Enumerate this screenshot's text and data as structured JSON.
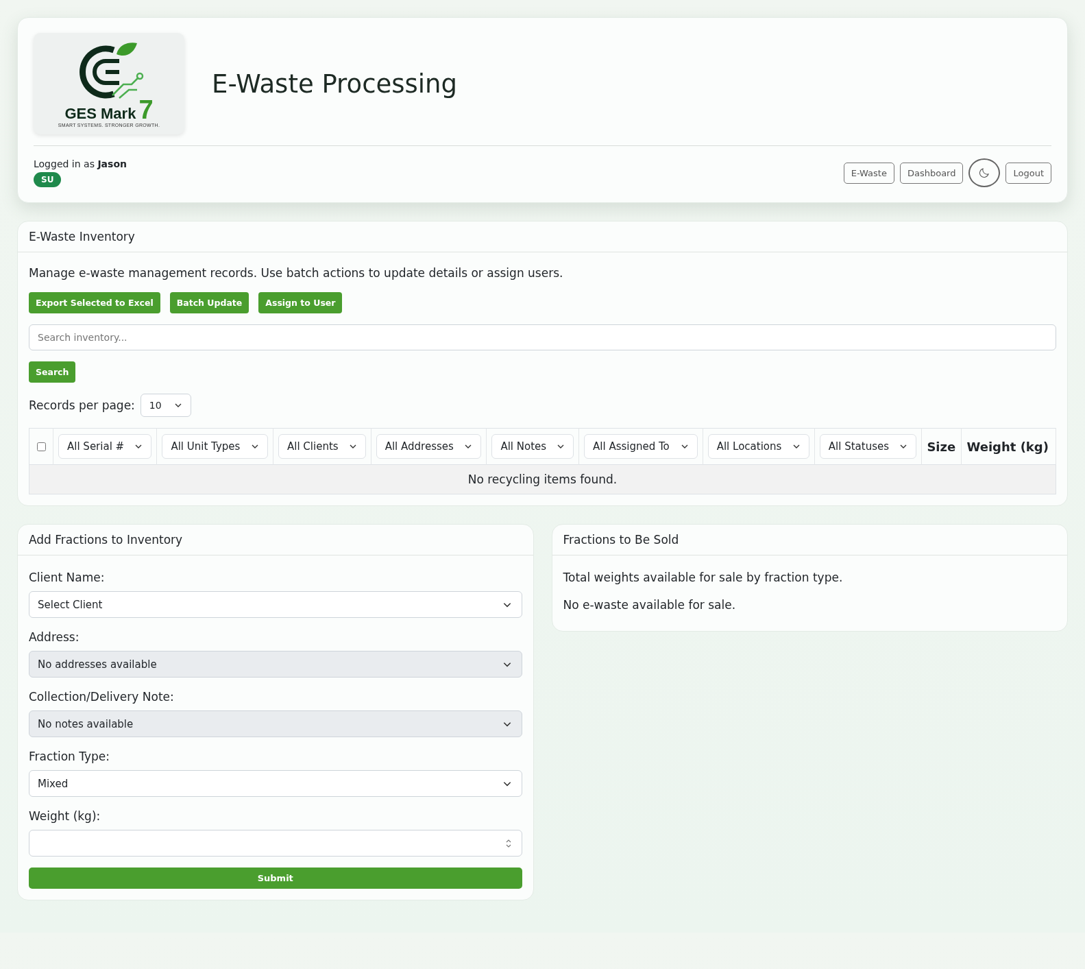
{
  "header": {
    "logo": {
      "brand": "GES Mark",
      "number": "7",
      "tagline": "SMART SYSTEMS. STRONGER GROWTH."
    },
    "title": "E-Waste Processing",
    "user": {
      "prefix": "Logged in as",
      "name": "Jason",
      "role": "SU"
    },
    "nav": [
      {
        "kind": "button",
        "label": "E-Waste"
      },
      {
        "kind": "button",
        "label": "Dashboard"
      },
      {
        "kind": "theme"
      },
      {
        "kind": "button",
        "label": "Logout"
      }
    ]
  },
  "inventory": {
    "title": "E-Waste Inventory",
    "description": "Manage e-waste management records. Use batch actions to update details or assign users.",
    "actions": [
      "Export Selected to Excel",
      "Batch Update",
      "Assign to User"
    ],
    "search": {
      "placeholder": "Search inventory..."
    },
    "search_button": "Search",
    "records_per_page": {
      "label": "Records per page:",
      "value": "10"
    },
    "table": {
      "select_all_checked": false,
      "columns": [
        {
          "kind": "filter",
          "label": "All Serial #"
        },
        {
          "kind": "filter",
          "label": "All Unit Types"
        },
        {
          "kind": "filter",
          "label": "All Clients"
        },
        {
          "kind": "filter",
          "label": "All Addresses"
        },
        {
          "kind": "filter",
          "label": "All Notes"
        },
        {
          "kind": "filter",
          "label": "All Assigned To"
        },
        {
          "kind": "filter",
          "label": "All Locations"
        },
        {
          "kind": "filter",
          "label": "All Statuses"
        },
        {
          "kind": "heading",
          "label": "Size"
        },
        {
          "kind": "heading",
          "label": "Weight (kg)"
        }
      ],
      "empty_message": "No recycling items found."
    }
  },
  "add_fractions": {
    "title": "Add Fractions to Inventory",
    "fields": [
      {
        "kind": "select",
        "label": "Client Name:",
        "value": "Select Client",
        "disabled": false
      },
      {
        "kind": "select",
        "label": "Address:",
        "value": "No addresses available",
        "disabled": true
      },
      {
        "kind": "select",
        "label": "Collection/Delivery Note:",
        "value": "No notes available",
        "disabled": true
      },
      {
        "kind": "select",
        "label": "Fraction Type:",
        "value": "Mixed",
        "disabled": false
      },
      {
        "kind": "number",
        "label": "Weight (kg):",
        "disabled": false
      }
    ],
    "submit": "Submit"
  },
  "fractions_sold": {
    "title": "Fractions to Be Sold",
    "description": "Total weights available for sale by fraction type.",
    "empty_message": "No e-waste available for sale."
  }
}
